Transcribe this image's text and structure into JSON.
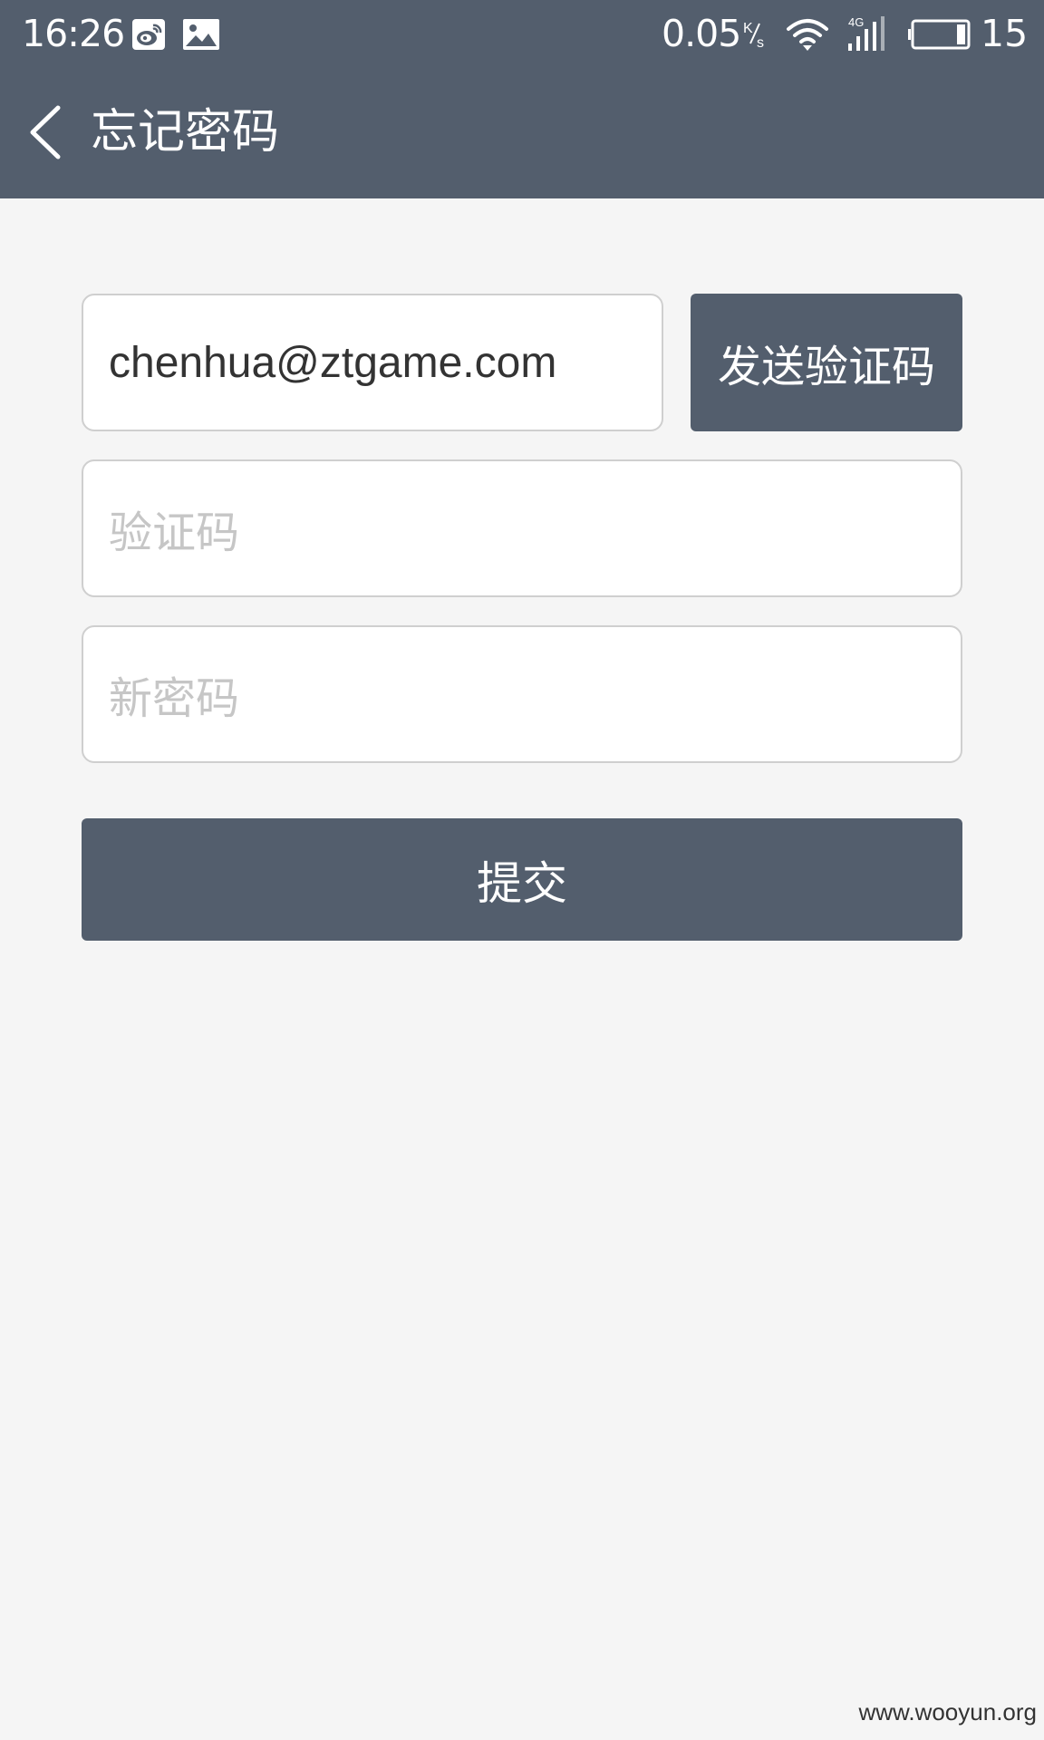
{
  "status_bar": {
    "time": "16:26",
    "icons": [
      "weibo-icon",
      "gallery-icon",
      "wifi-icon",
      "signal-4g-icon",
      "battery-icon"
    ],
    "net_speed": "0.05",
    "net_speed_unit": "K/s",
    "network_type": "4G",
    "battery_level": "15"
  },
  "header": {
    "back_icon": "chevron-left-icon",
    "title": "忘记密码"
  },
  "form": {
    "email_value": "chenhua@ztgame.com",
    "send_code_label": "发送验证码",
    "code_placeholder": "验证码",
    "new_password_placeholder": "新密码",
    "submit_label": "提交"
  },
  "watermark": "www.wooyun.org",
  "colors": {
    "header_bg": "#535e6d",
    "page_bg": "#f5f5f5",
    "button_bg": "#535e6d",
    "placeholder": "#c6c6c6"
  }
}
